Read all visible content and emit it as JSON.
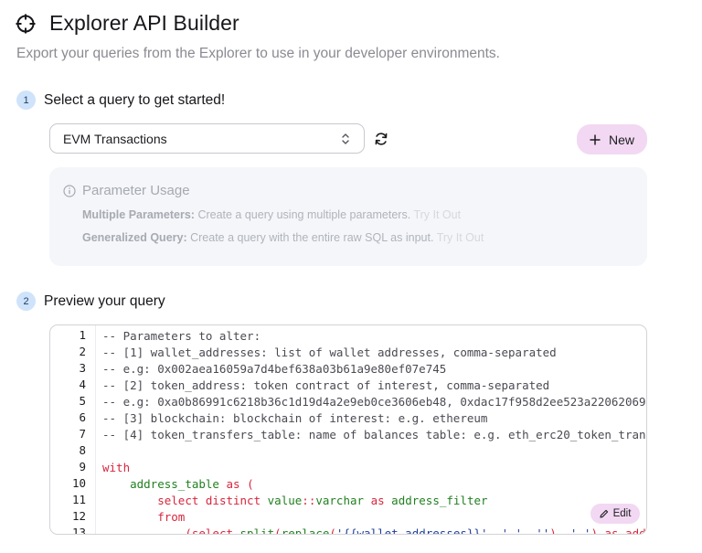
{
  "header": {
    "title": "Explorer API Builder",
    "subtitle": "Export your queries from the Explorer to use in your developer environments."
  },
  "steps": [
    {
      "number": "1",
      "label": "Select a query to get started!"
    },
    {
      "number": "2",
      "label": "Preview your query"
    }
  ],
  "query_select": {
    "value": "EVM Transactions"
  },
  "new_button": {
    "label": "New"
  },
  "parameter_usage": {
    "title": "Parameter Usage",
    "rows": [
      {
        "name": "Multiple Parameters:",
        "text": " Create a query using multiple parameters. ",
        "link": "Try It Out"
      },
      {
        "name": "Generalized Query:",
        "text": " Create a query with the entire raw SQL as input. ",
        "link": "Try It Out"
      }
    ]
  },
  "editor": {
    "line_numbers": [
      "1",
      "2",
      "3",
      "4",
      "5",
      "6",
      "7",
      "8",
      "9",
      "10",
      "11",
      "12",
      "13"
    ],
    "lines": [
      "-- Parameters to alter:",
      "-- [1] wallet_addresses: list of wallet addresses, comma-separated",
      "-- e.g: 0x002aea16059a7d4bef638a03b61a9e80ef07e745",
      "-- [2] token_address: token contract of interest, comma-separated",
      "-- e.g: 0xa0b86991c6218b36c1d19d4a2e9eb0ce3606eb48, 0xdac17f958d2ee523a22062069",
      "-- [3] blockchain: blockchain of interest: e.g. ethereum",
      "-- [4] token_transfers_table: name of balances table: e.g. eth_erc20_token_tran",
      "",
      "with",
      "    address_table as (",
      "        select distinct value::varchar as address_filter",
      "        from",
      "            (select split(replace('{{wallet_addresses}}', ' ', ''), ',') as add"
    ],
    "edit_label": "Edit"
  },
  "colors": {
    "accent_pink": "#f2d8f2",
    "step_badge": "#cfe3fb",
    "keyword": "#d7263d",
    "identifier": "#218021",
    "string": "#1e3f99"
  }
}
